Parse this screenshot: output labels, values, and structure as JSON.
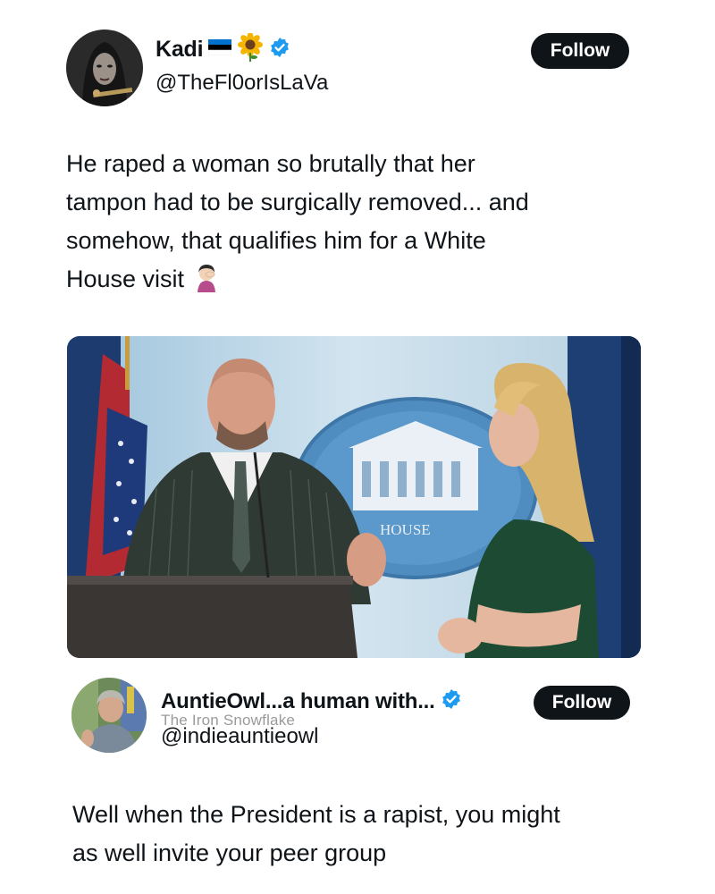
{
  "tweet1": {
    "display_name": "Kadi",
    "flag_emoji": "🇪🇪",
    "flower_emoji": "🌻",
    "verified_icon": "verified-badge-icon",
    "handle": "@TheFl0orIsLaVa",
    "follow_label": "Follow",
    "text": "He raped a woman so brutally that her\ntampon had to be surgically removed... and\nsomehow, that qualifies him for a White\nHouse visit ",
    "text_emoji": "🤦‍♀️",
    "media": {
      "sign_text": "HOUSE"
    }
  },
  "watermark": "The Iron Snowflake",
  "tweet2": {
    "display_name": "AuntieOwl...a human with...",
    "verified_icon": "verified-badge-icon",
    "handle": "@indieauntieowl",
    "follow_label": "Follow",
    "text": "Well when the President is a rapist, you might\nas well invite your peer group"
  },
  "colors": {
    "verified_blue": "#1d9bf0",
    "button_bg": "#0f1419",
    "text": "#0f1419"
  }
}
